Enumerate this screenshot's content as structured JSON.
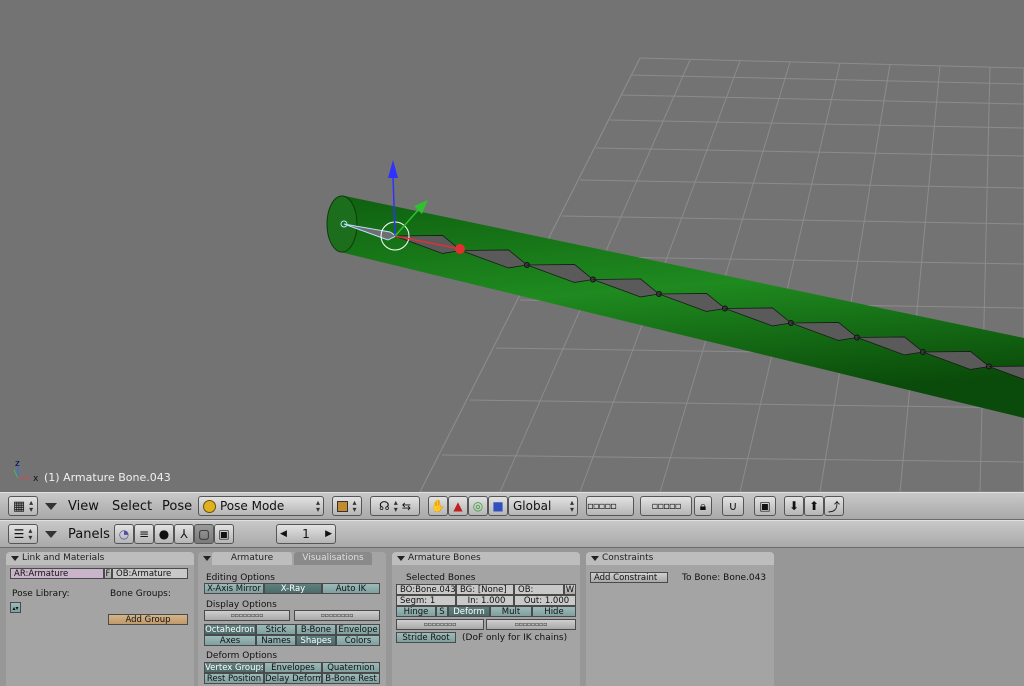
{
  "viewport": {
    "info_text": "(1) Armature Bone.043",
    "colors": {
      "background": "#737373",
      "grid": "#8a8a8a",
      "cylinder": "#1f7a1f",
      "bone": "#4a4a4a"
    }
  },
  "view_header": {
    "menus": [
      "View",
      "Select",
      "Pose"
    ],
    "mode": "Pose Mode",
    "orientation": "Global"
  },
  "buttons_header": {
    "panels_label": "Panels",
    "frame": "1"
  },
  "link_materials": {
    "title": "Link and Materials",
    "ar_field": "AR:Armature",
    "f_label": "F",
    "ob_field": "OB:Armature",
    "pose_library_label": "Pose Library:",
    "bone_groups_label": "Bone Groups:",
    "add_group_label": "Add Group"
  },
  "armature": {
    "tab_active": "Armature",
    "tab_inactive": "Visualisations",
    "editing_options_label": "Editing Options",
    "x_axis_mirror": "X-Axis Mirror",
    "x_ray": "X-Ray",
    "auto_ik": "Auto IK",
    "display_options_label": "Display Options",
    "octahedron": "Octahedron",
    "stick": "Stick",
    "b_bone": "B-Bone",
    "envelope": "Envelope",
    "axes": "Axes",
    "names": "Names",
    "shapes": "Shapes",
    "colors": "Colors",
    "deform_options_label": "Deform Options",
    "vertex_groups": "Vertex Groups",
    "envelopes": "Envelopes",
    "quaternion": "Quaternion",
    "rest_position": "Rest Position",
    "delay_deform": "Delay Deform",
    "b_bone_rest": "B-Bone Rest"
  },
  "armature_bones": {
    "title": "Armature Bones",
    "selected_bones_label": "Selected Bones",
    "bo_field": "BO:Bone.043",
    "bg_field": "BG: [None]",
    "ob_field": "OB:",
    "w_label": "W",
    "segm": "Segm: 1",
    "in": "In: 1.000",
    "out": "Out: 1.000",
    "hinge": "Hinge",
    "s_label": "S",
    "deform": "Deform",
    "mult": "Mult",
    "hide": "Hide",
    "stride_root": "Stride Root",
    "dof_note": "(DoF only for IK chains)"
  },
  "constraints": {
    "title": "Constraints",
    "add_constraint": "Add Constraint",
    "to_bone": "To Bone: Bone.043"
  }
}
